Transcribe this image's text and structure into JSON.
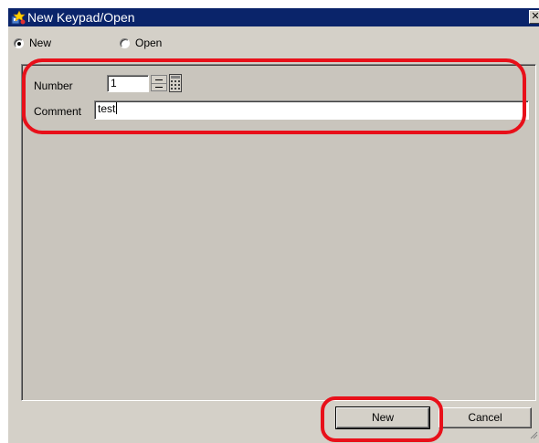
{
  "window": {
    "title": "New Keypad/Open"
  },
  "mode": {
    "options": [
      {
        "label": "New",
        "checked": true
      },
      {
        "label": "Open",
        "checked": false
      }
    ]
  },
  "form": {
    "number_label": "Number",
    "number_value": "1",
    "comment_label": "Comment",
    "comment_value": "test"
  },
  "buttons": {
    "new_label": "New",
    "cancel_label": "Cancel"
  },
  "icons": {
    "app": "app-icon",
    "close": "close-icon",
    "spin_up": "spin-up-icon",
    "spin_down": "spin-down-icon",
    "keypad": "keypad-icon",
    "grip": "resize-grip-icon"
  },
  "colors": {
    "titlebar": "#0a246a",
    "dialog": "#d4d0c8",
    "highlight": "#e8101a"
  }
}
